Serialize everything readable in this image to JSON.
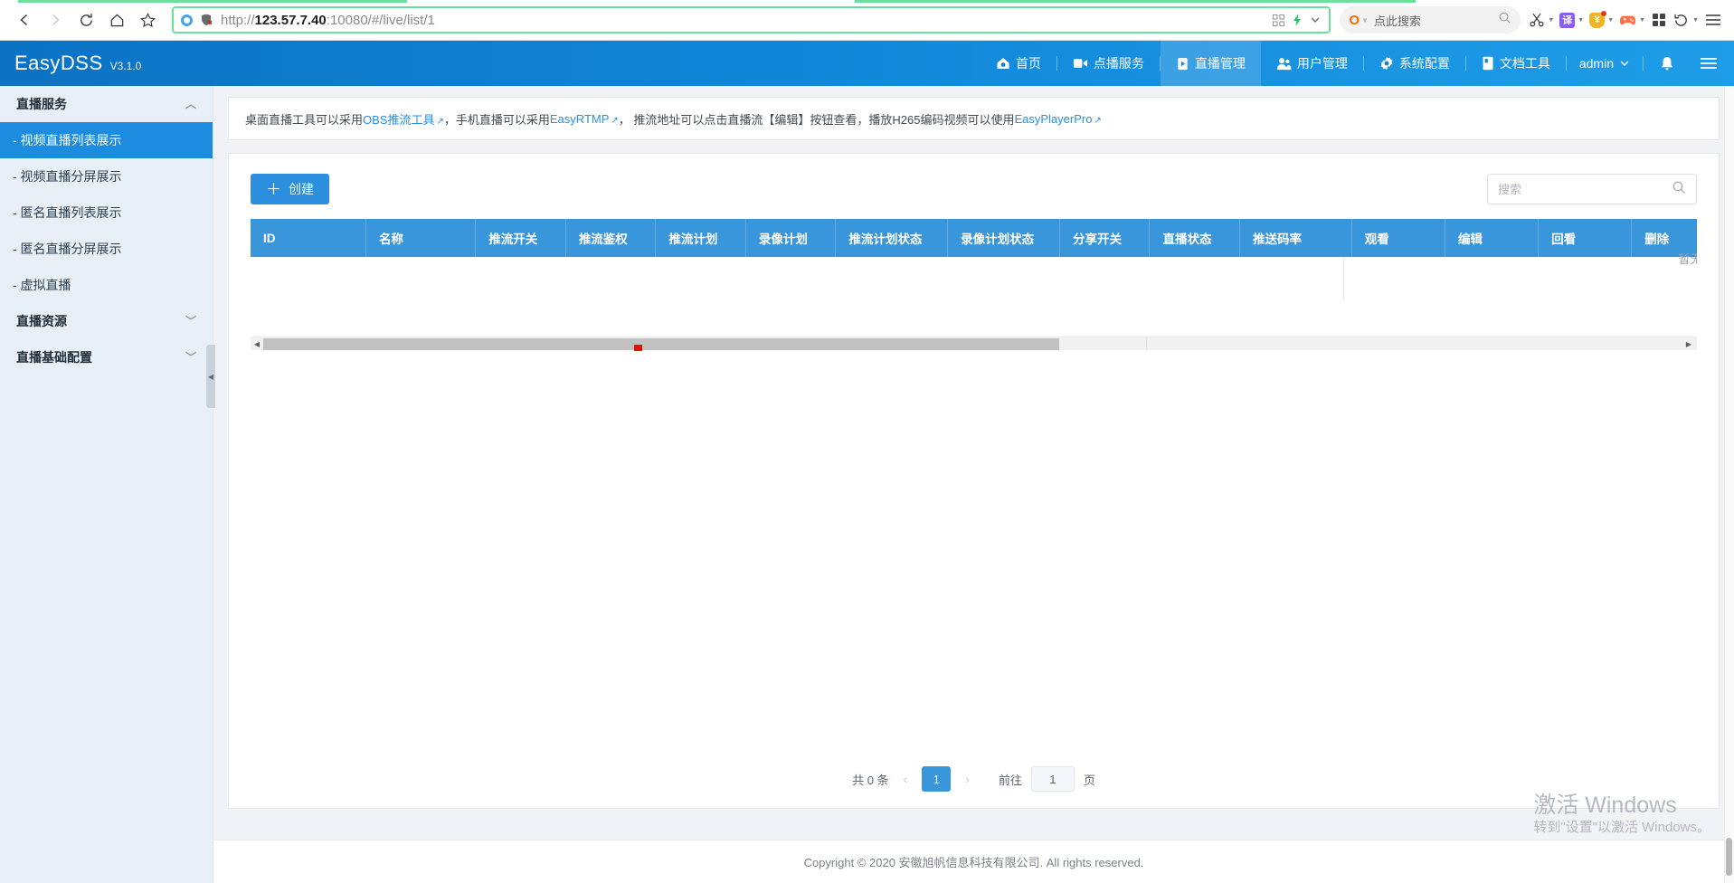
{
  "browser": {
    "nav": {
      "back": "back-arrow",
      "forward": "forward-arrow",
      "reload": "reload",
      "home": "home",
      "bookmark": "star"
    },
    "url": {
      "scheme": "http://",
      "host": "123.57.7.40",
      "rest": ":10080/#/live/list/1",
      "full": "http://123.57.7.40:10080/#/live/list/1"
    },
    "search": {
      "engine_mark": "O",
      "placeholder": "点此搜索"
    },
    "toolbar_icons": [
      {
        "name": "scissors-icon",
        "label": "✂"
      },
      {
        "name": "translate-icon",
        "label": "译",
        "color": "#8b5cf6"
      },
      {
        "name": "coupon-icon",
        "label": "¥",
        "color": "#f0b429"
      },
      {
        "name": "game-icon",
        "label": "🎮",
        "color": "#ff7043"
      },
      {
        "name": "apps-grid-icon",
        "label": "apps"
      },
      {
        "name": "history-icon",
        "label": "↺"
      },
      {
        "name": "menu-icon",
        "label": "☰"
      }
    ]
  },
  "app": {
    "brand": "EasyDSS",
    "version": "V3.1.0",
    "topnav": [
      {
        "key": "home",
        "label": "首页",
        "icon": "home-icon",
        "active": false
      },
      {
        "key": "vod",
        "label": "点播服务",
        "icon": "video-icon",
        "active": false
      },
      {
        "key": "live",
        "label": "直播管理",
        "icon": "live-icon",
        "active": true
      },
      {
        "key": "users",
        "label": "用户管理",
        "icon": "user-icon",
        "active": false
      },
      {
        "key": "system",
        "label": "系统配置",
        "icon": "gear-icon",
        "active": false
      },
      {
        "key": "docs",
        "label": "文档工具",
        "icon": "doc-icon",
        "active": false
      }
    ],
    "user": "admin",
    "bell": "bell-icon",
    "hamburger": "hamburger-icon"
  },
  "sidebar": {
    "groups": [
      {
        "label": "直播服务",
        "expanded": true,
        "items": [
          {
            "label": "- 视频直播列表展示",
            "active": true
          },
          {
            "label": "- 视频直播分屏展示",
            "active": false
          },
          {
            "label": "- 匿名直播列表展示",
            "active": false
          },
          {
            "label": "- 匿名直播分屏展示",
            "active": false
          },
          {
            "label": "- 虚拟直播",
            "active": false
          }
        ]
      },
      {
        "label": "直播资源",
        "expanded": false,
        "items": []
      },
      {
        "label": "直播基础配置",
        "expanded": false,
        "items": []
      }
    ]
  },
  "notice": {
    "t1": "桌面直播工具可以采用 ",
    "link1": "OBS推流工具",
    "t2": "，手机直播可以采用 ",
    "link2": "EasyRTMP",
    "t3": "，  推流地址可以点击直播流【编辑】按钮查看，播放H265编码视频可以使用 ",
    "link3": "EasyPlayerPro"
  },
  "toolbar": {
    "create_label": "创建",
    "create_plus": "＋",
    "search_placeholder": "搜索",
    "search_value": ""
  },
  "table": {
    "columns": [
      "ID",
      "名称",
      "推流开关",
      "推流鉴权",
      "推流计划",
      "录像计划",
      "推流计划状态",
      "录像计划状态",
      "分享开关",
      "直播状态",
      "推送码率",
      "观看",
      "编辑",
      "回看",
      "删除"
    ],
    "rows": [],
    "empty_text": "暂无数据"
  },
  "pagination": {
    "total_label": "共 0 条",
    "prev": "‹",
    "next": "›",
    "current_page": "1",
    "jump_prefix": "前往",
    "jump_value": "1",
    "jump_suffix": "页"
  },
  "footer": {
    "text": "Copyright © 2020 安徽旭帆信息科技有限公司. All rights reserved."
  },
  "watermark": {
    "title": "激活 Windows",
    "subtitle": "转到\"设置\"以激活 Windows。"
  },
  "colors": {
    "brand_blue": "#1186d8",
    "table_header": "#3a96da",
    "accent": "#2b8ede",
    "sidebar_bg": "#e8eff7",
    "scroll_marker": "#e81000"
  }
}
